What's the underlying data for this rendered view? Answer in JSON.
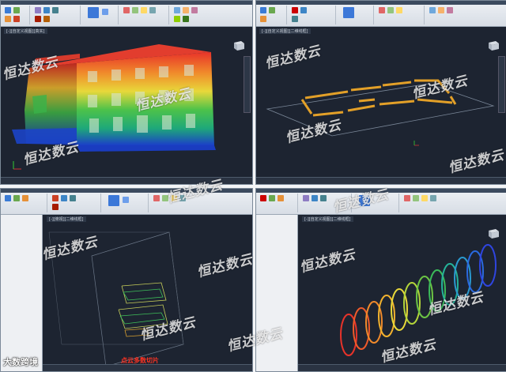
{
  "watermark": "恒达数云",
  "caption_red": "点云多数切片",
  "brand": "大数跨境",
  "brand_prefix": "",
  "panels": {
    "tl": {
      "name": "building-pointcloud-viewport"
    },
    "tr": {
      "name": "floor-slice-viewport"
    },
    "bl": {
      "name": "multi-slice-viewport"
    },
    "br": {
      "name": "tunnel-rings-viewport"
    }
  },
  "colors": {
    "ribbon_top": "#eef1f5",
    "viewport_bg": "#1d2431",
    "accent_red": "#ff3322",
    "slice_orange": "#e3a028"
  }
}
